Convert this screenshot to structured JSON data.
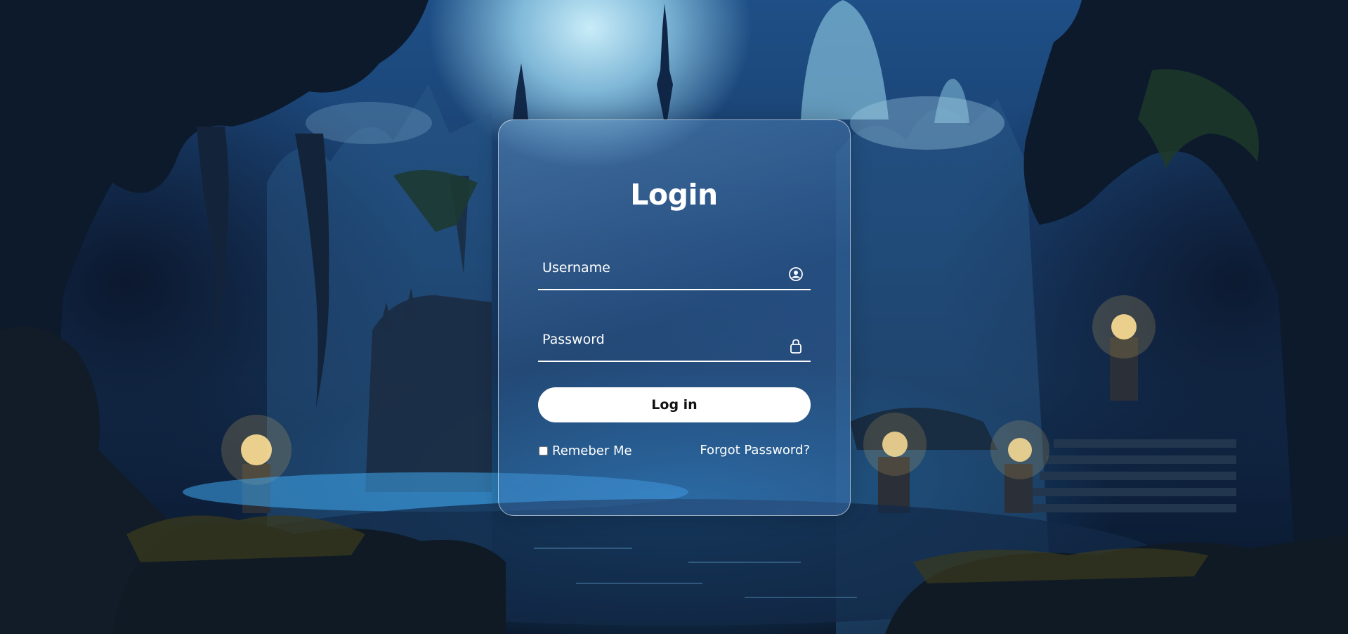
{
  "login": {
    "title": "Login",
    "username_placeholder": "Username",
    "password_placeholder": "Password",
    "login_button": "Log in",
    "remember_label": "Remeber Me",
    "forgot_link": "Forgot Password?",
    "username_icon": "user-circle-icon",
    "password_icon": "lock-icon"
  },
  "colors": {
    "text": "#ffffff",
    "button_bg": "#ffffff",
    "button_text": "#111111",
    "sky_blue": "#1e4f86",
    "moon_glow": "#d2f5ff"
  }
}
